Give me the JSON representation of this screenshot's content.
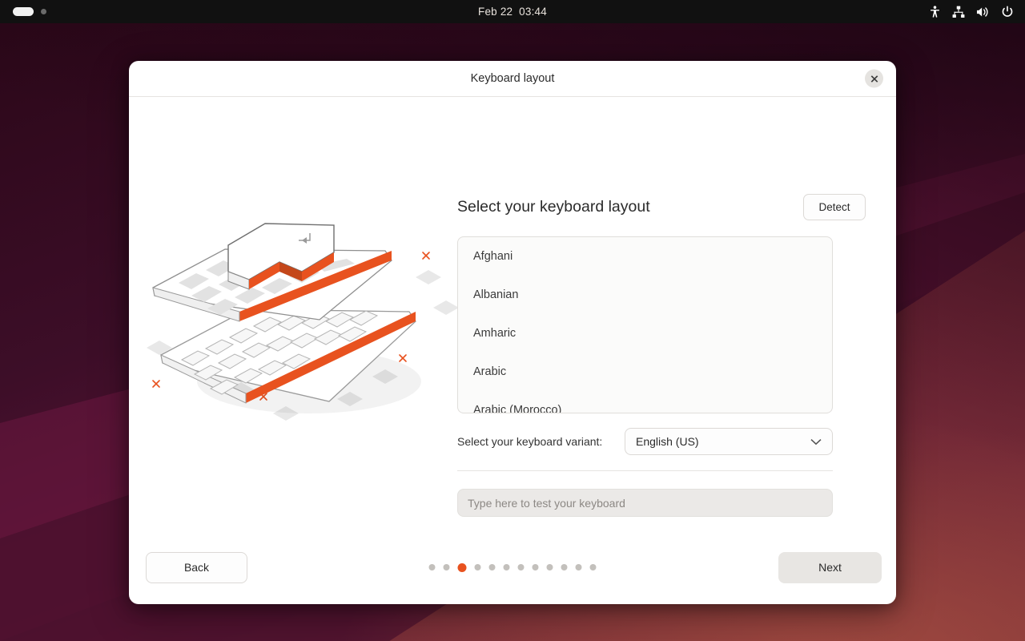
{
  "colors": {
    "accent": "#e8521f",
    "topbar_bg": "#111111",
    "dialog_bg": "#ffffff",
    "wallpaper_dark": "#2a0718",
    "wallpaper_mid": "#5b1436",
    "wallpaper_warm": "#8e3a3c",
    "dot_inactive": "#c3c0bc",
    "text_primary": "#2b2b2b",
    "field_bg": "#ebe9e7"
  },
  "topbar": {
    "clock": "Feb 22  03:44",
    "workspace_indicators": [
      "active-pill",
      "inactive-dot"
    ],
    "tray_icons": [
      {
        "name": "accessibility-icon",
        "label": "Accessibility"
      },
      {
        "name": "network-icon",
        "label": "Network"
      },
      {
        "name": "volume-icon",
        "label": "Volume"
      },
      {
        "name": "power-icon",
        "label": "Power"
      }
    ]
  },
  "dialog": {
    "title": "Keyboard layout",
    "close_label": "Close"
  },
  "pane": {
    "heading": "Select your keyboard layout",
    "detect_label": "Detect",
    "layout_list": [
      {
        "label": "Afghani",
        "selected": false
      },
      {
        "label": "Albanian",
        "selected": false
      },
      {
        "label": "Amharic",
        "selected": false
      },
      {
        "label": "Arabic",
        "selected": false
      },
      {
        "label": "Arabic (Morocco)",
        "selected": false
      }
    ],
    "variant_label": "Select your keyboard variant:",
    "variant_value": "English (US)",
    "variant_options": [
      "English (US)"
    ],
    "test_placeholder": "Type here to test your keyboard",
    "test_value": ""
  },
  "footer": {
    "back_label": "Back",
    "next_label": "Next",
    "page_total": 12,
    "page_current": 3
  },
  "illustration": {
    "name": "keyboard-layers-illustration",
    "accent": "#e8521f"
  }
}
